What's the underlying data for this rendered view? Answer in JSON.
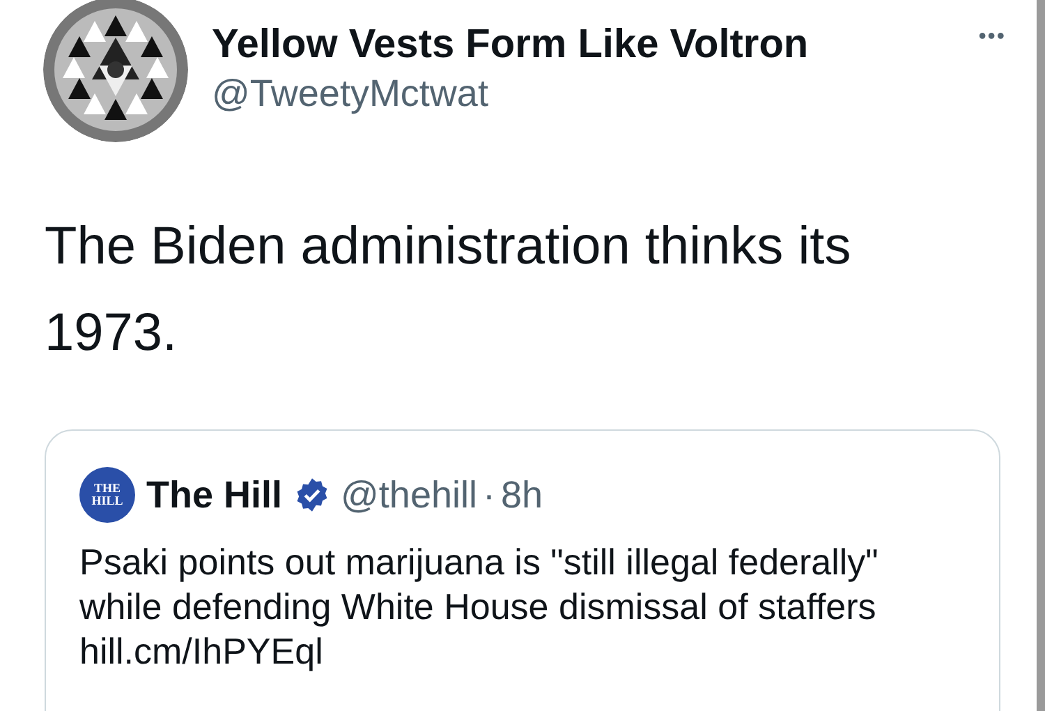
{
  "author": {
    "name": "Yellow Vests Form Like Voltron",
    "handle": "@TweetyMctwat"
  },
  "more_menu": "•••",
  "tweet_text": "The Biden administration thinks its 1973.",
  "quoted_tweet": {
    "logo_text": "THE HILL",
    "name": "The Hill",
    "verified": true,
    "handle": "@thehill",
    "separator": "·",
    "time": "8h",
    "text": "Psaki points out marijuana is \"still illegal federally\" while defending White House dismissal of staffers hill.cm/IhPYEql"
  }
}
